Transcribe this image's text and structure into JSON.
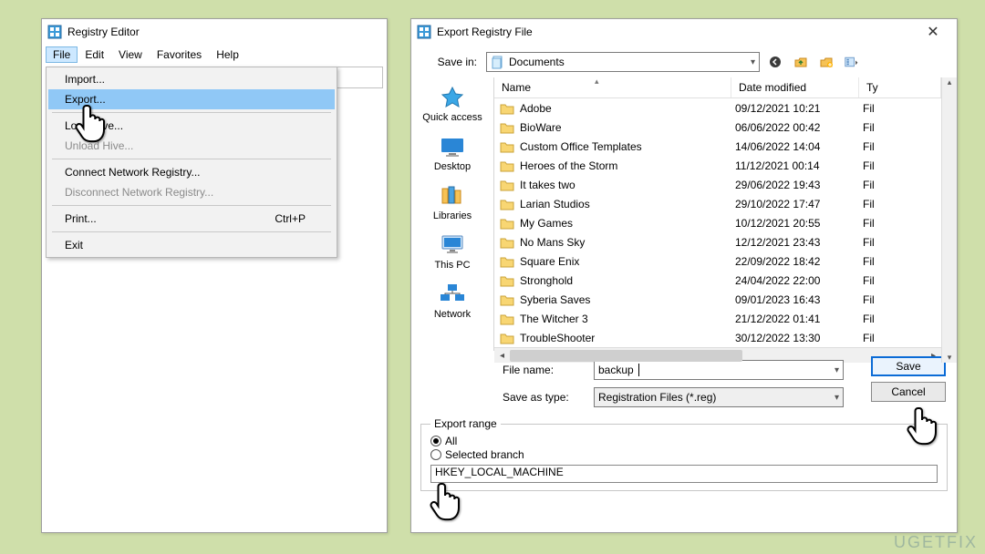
{
  "regedit": {
    "title": "Registry Editor",
    "menus": [
      "File",
      "Edit",
      "View",
      "Favorites",
      "Help"
    ],
    "file_menu": {
      "import": "Import...",
      "export": "Export...",
      "load_hive": "Load Hive...",
      "unload_hive": "Unload Hive...",
      "connect": "Connect Network Registry...",
      "disconnect": "Disconnect Network Registry...",
      "print": "Print...",
      "print_accel": "Ctrl+P",
      "exit": "Exit"
    }
  },
  "dialog": {
    "title": "Export Registry File",
    "save_in_label": "Save in:",
    "save_in_value": "Documents",
    "columns": {
      "name": "Name",
      "date": "Date modified",
      "type": "Ty"
    },
    "places": {
      "quick_access": "Quick access",
      "desktop": "Desktop",
      "libraries": "Libraries",
      "this_pc": "This PC",
      "network": "Network"
    },
    "rows": [
      {
        "name": "Adobe",
        "date": "09/12/2021 10:21",
        "type": "Fil"
      },
      {
        "name": "BioWare",
        "date": "06/06/2022 00:42",
        "type": "Fil"
      },
      {
        "name": "Custom Office Templates",
        "date": "14/06/2022 14:04",
        "type": "Fil"
      },
      {
        "name": "Heroes of the Storm",
        "date": "11/12/2021 00:14",
        "type": "Fil"
      },
      {
        "name": "It takes two",
        "date": "29/06/2022 19:43",
        "type": "Fil"
      },
      {
        "name": "Larian Studios",
        "date": "29/10/2022 17:47",
        "type": "Fil"
      },
      {
        "name": "My Games",
        "date": "10/12/2021 20:55",
        "type": "Fil"
      },
      {
        "name": "No Mans Sky",
        "date": "12/12/2021 23:43",
        "type": "Fil"
      },
      {
        "name": "Square Enix",
        "date": "22/09/2022 18:42",
        "type": "Fil"
      },
      {
        "name": "Stronghold",
        "date": "24/04/2022 22:00",
        "type": "Fil"
      },
      {
        "name": "Syberia Saves",
        "date": "09/01/2023 16:43",
        "type": "Fil"
      },
      {
        "name": "The Witcher 3",
        "date": "21/12/2022 01:41",
        "type": "Fil"
      },
      {
        "name": "TroubleShooter",
        "date": "30/12/2022 13:30",
        "type": "Fil"
      }
    ],
    "file_name_label": "File name:",
    "file_name_value": "backup",
    "save_as_type_label": "Save as type:",
    "save_as_type_value": "Registration Files (*.reg)",
    "save_btn": "Save",
    "cancel_btn": "Cancel",
    "export_range": {
      "legend": "Export range",
      "all": "All",
      "selected": "Selected branch",
      "branch_value": "HKEY_LOCAL_MACHINE"
    }
  },
  "watermark": "UGETFIX"
}
